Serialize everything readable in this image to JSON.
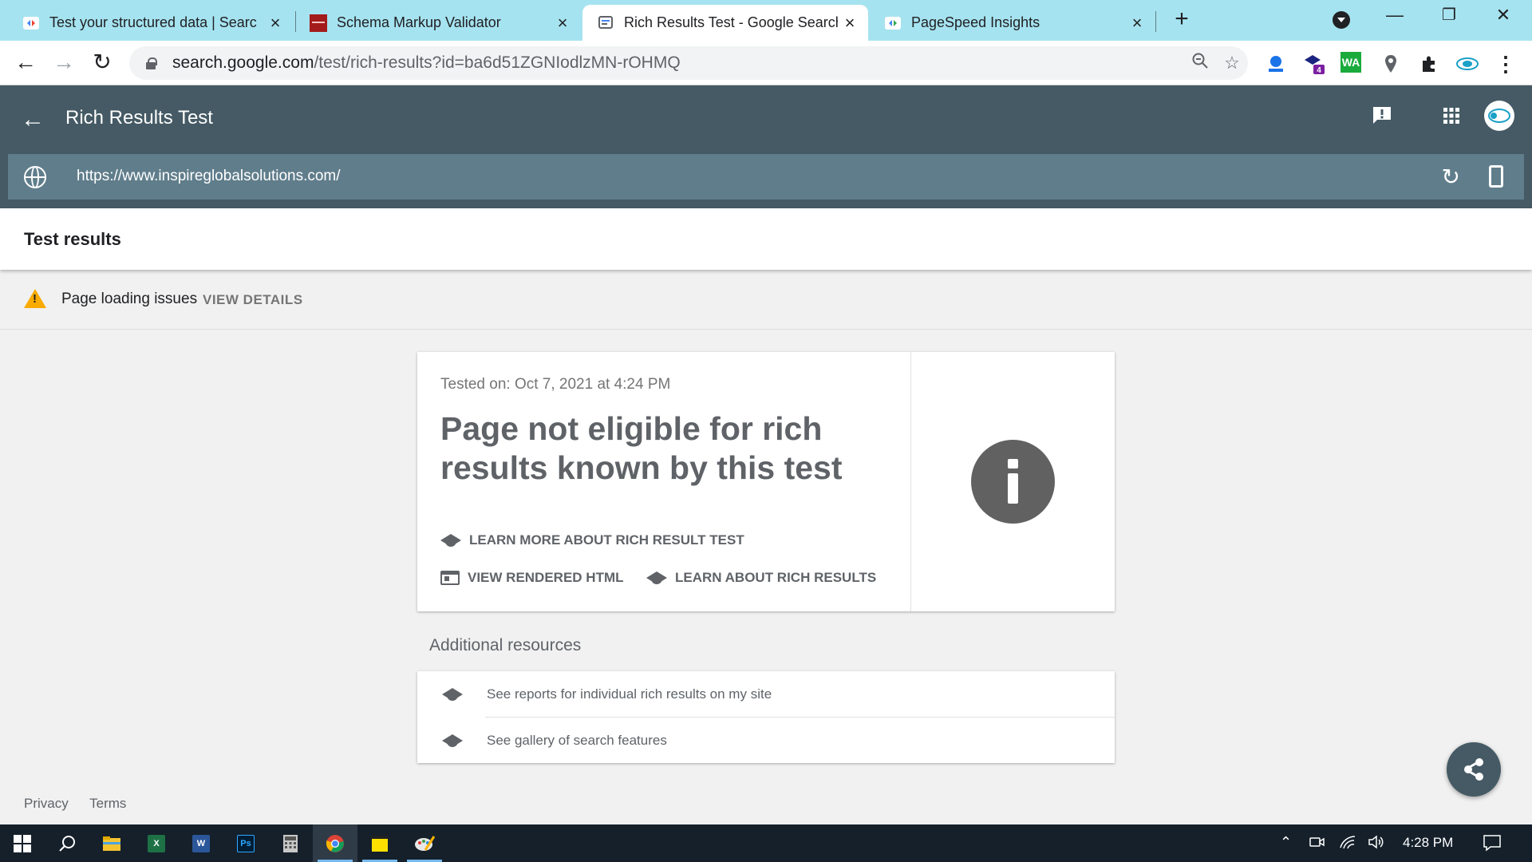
{
  "browser": {
    "tabs": [
      {
        "title": "Test your structured data  |  Searc",
        "active": false
      },
      {
        "title": "Schema Markup Validator",
        "active": false
      },
      {
        "title": "Rich Results Test - Google Search",
        "active": true
      },
      {
        "title": "PageSpeed Insights",
        "active": false
      }
    ],
    "address": {
      "host": "search.google.com",
      "path": "/test/rich-results?id=ba6d51ZGNIodlzMN-rOHMQ"
    },
    "extensions": [
      "alexa-icon",
      "bookmark-badge-icon",
      "wa-icon",
      "location-pin-icon",
      "puzzle-icon",
      "igs-icon"
    ],
    "extension_badge": "4",
    "extension_wa_label": "WA"
  },
  "app": {
    "title": "Rich Results Test",
    "tested_url": "https://www.inspireglobalsolutions.com/"
  },
  "results": {
    "heading": "Test results",
    "issue_text": "Page loading issues",
    "issue_action": "VIEW DETAILS",
    "tested_on": "Tested on: Oct 7, 2021 at 4:24 PM",
    "headline": "Page not eligible for rich results known by this test",
    "links": {
      "learn_more": "LEARN MORE ABOUT RICH RESULT TEST",
      "view_html": "VIEW RENDERED HTML",
      "learn_rich": "LEARN ABOUT RICH RESULTS"
    }
  },
  "additional": {
    "title": "Additional resources",
    "items": [
      "See reports for individual rich results on my site",
      "See gallery of search features"
    ]
  },
  "footer": {
    "privacy": "Privacy",
    "terms": "Terms"
  },
  "taskbar": {
    "clock": "4:28 PM"
  },
  "colors": {
    "header": "#455a64",
    "urlbar": "#607d8b",
    "tabstrip": "#a6e3f0",
    "warning": "#f9ab00",
    "taskbar": "#15202b"
  }
}
